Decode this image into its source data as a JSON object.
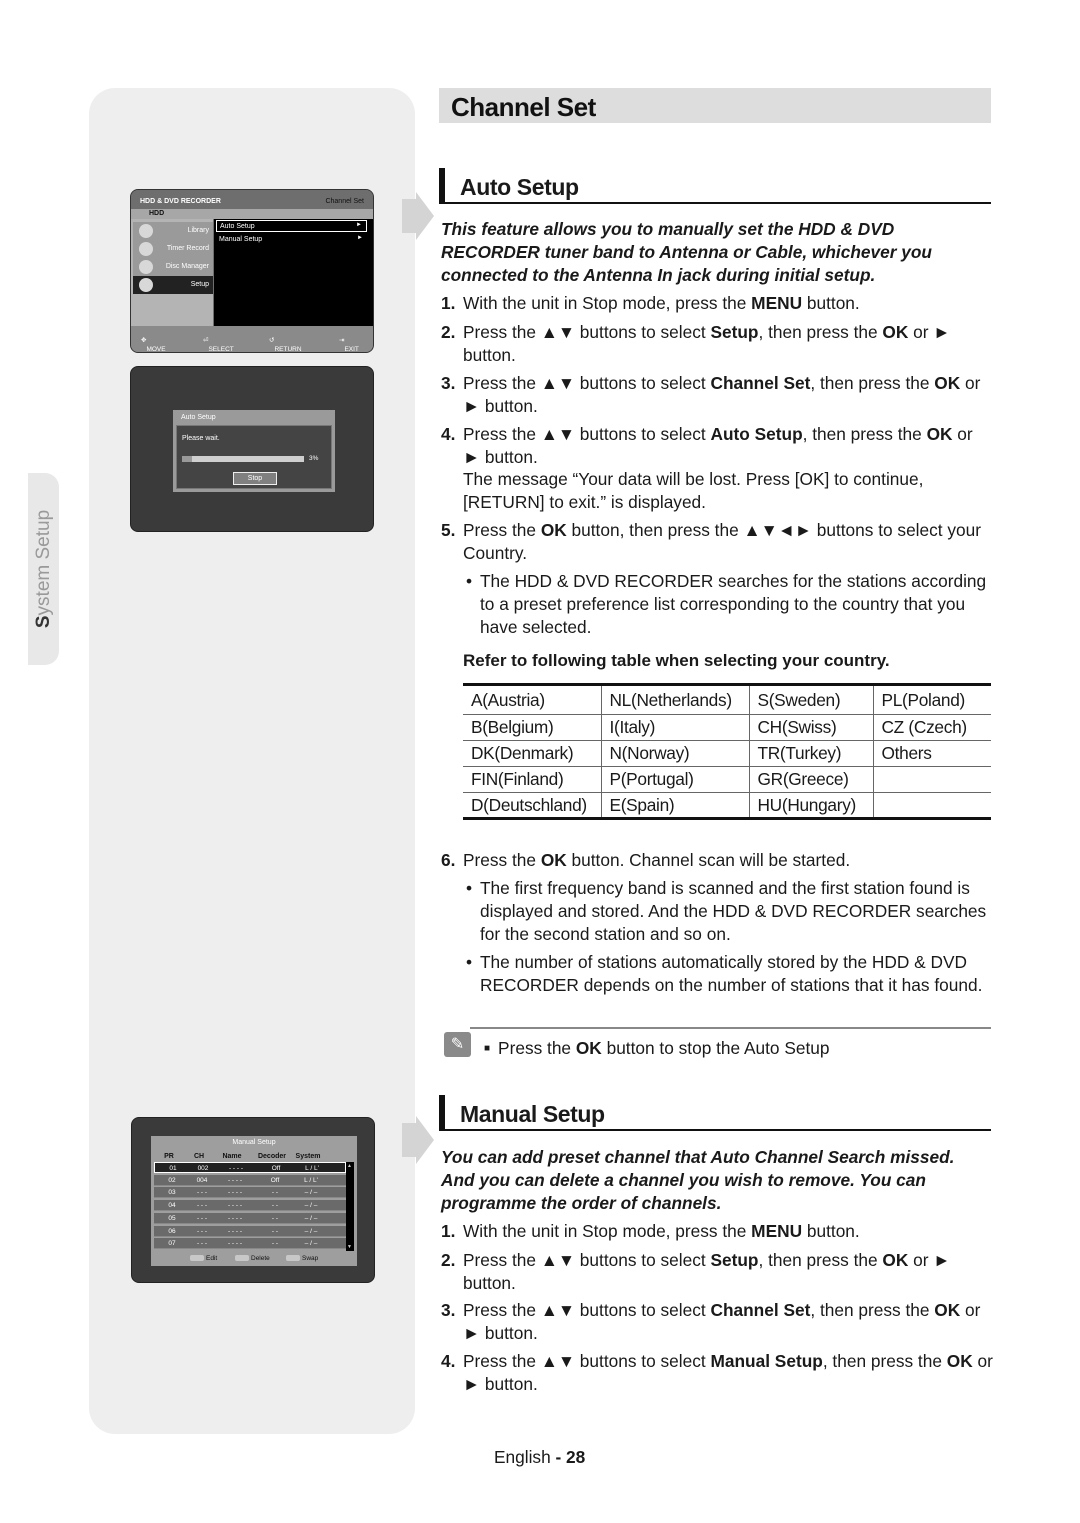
{
  "side_tab": {
    "label_first": "S",
    "label_rest": "ystem Setup"
  },
  "screen1": {
    "header_title": "HDD & DVD RECORDER",
    "header_right": "Channel Set",
    "hdd_label": "HDD",
    "menu": [
      {
        "label": "Library",
        "icon": "library-icon"
      },
      {
        "label": "Timer Record",
        "icon": "timer-icon"
      },
      {
        "label": "Disc Manager",
        "icon": "disc-icon"
      },
      {
        "label": "Setup",
        "icon": "gear-icon",
        "active": true
      }
    ],
    "options": [
      {
        "label": "Auto Setup",
        "arrow": "►",
        "selected": true
      },
      {
        "label": "Manual Setup",
        "arrow": "►"
      }
    ],
    "footer": {
      "move": "MOVE",
      "select": "SELECT",
      "return": "RETURN",
      "exit": "EXIT"
    }
  },
  "screen2": {
    "title": "Auto Setup",
    "message": "Please wait.",
    "progress_percent": 3,
    "progress_label": "3%",
    "stop_label": "Stop"
  },
  "screen3": {
    "title": "Manual Setup",
    "columns": [
      "PR",
      "CH",
      "Name",
      "Decoder",
      "System"
    ],
    "rows": [
      [
        "01",
        "002",
        "- - - -",
        "Off",
        "L / L'"
      ],
      [
        "02",
        "004",
        "- - - -",
        "Off",
        "L / L'"
      ],
      [
        "03",
        "- - -",
        "- - - -",
        "- -",
        "– / –"
      ],
      [
        "04",
        "- - -",
        "- - - -",
        "- -",
        "– / –"
      ],
      [
        "05",
        "- - -",
        "- - - -",
        "- -",
        "– / –"
      ],
      [
        "06",
        "- - -",
        "- - - -",
        "- -",
        "– / –"
      ],
      [
        "07",
        "- - -",
        "- - - -",
        "- -",
        "– / –"
      ]
    ],
    "footer": {
      "edit": "Edit",
      "delete": "Delete",
      "swap": "Swap"
    }
  },
  "page_title": "Channel Set",
  "auto_setup": {
    "heading": "Auto Setup",
    "intro": "This feature allows you to manually set the HDD & DVD RECORDER tuner band to Antenna or Cable, whichever you connected to the Antenna In jack during initial setup.",
    "steps": [
      {
        "n": "1.",
        "pre": "With the unit in Stop mode, press the ",
        "b1": "MENU",
        "mid": " button.",
        "b2": "",
        "post": ""
      },
      {
        "n": "2.",
        "pre": "Press the ▲▼ buttons to select ",
        "b1": "Setup",
        "mid": ", then press the ",
        "b2": "OK",
        "post": " or ► button."
      },
      {
        "n": "3.",
        "pre": "Press the ▲▼ buttons to select ",
        "b1": "Channel Set",
        "mid": ", then press the ",
        "b2": "OK",
        "post": " or ► button."
      },
      {
        "n": "4.",
        "pre": "Press the ▲▼ buttons to select ",
        "b1": "Auto Setup",
        "mid": ", then press the ",
        "b2": "OK",
        "post": " or ► button."
      },
      {
        "n": "5.",
        "pre": "Press the ",
        "b1": "OK",
        "mid": " button, then press the ▲▼◄► buttons to select your Country.",
        "b2": "",
        "post": ""
      },
      {
        "n": "6.",
        "pre": "Press the ",
        "b1": "OK",
        "mid": " button. Channel scan will be started.",
        "b2": "",
        "post": ""
      }
    ],
    "step4_message": "The message “Your data will be lost. Press [OK] to continue, [RETURN] to exit.” is displayed.",
    "step5_bullet": "The HDD & DVD RECORDER searches for the stations according to a preset preference list corresponding to the country that you have selected.",
    "table_heading": "Refer to following table when selecting your country.",
    "countries": [
      [
        "A(Austria)",
        "NL(Netherlands)",
        "S(Sweden)",
        "PL(Poland)"
      ],
      [
        "B(Belgium)",
        "I(Italy)",
        "CH(Swiss)",
        "CZ (Czech)"
      ],
      [
        "DK(Denmark)",
        "N(Norway)",
        "TR(Turkey)",
        "Others"
      ],
      [
        "FIN(Finland)",
        "P(Portugal)",
        "GR(Greece)",
        ""
      ],
      [
        "D(Deutschland)",
        "E(Spain)",
        "HU(Hungary)",
        ""
      ]
    ],
    "step6_bullets": [
      "The first frequency band is scanned and the first station found is displayed and stored. And the HDD & DVD RECORDER searches for the second station and so on.",
      "The number of stations automatically stored by the HDD & DVD RECORDER depends on the number of stations that it has found."
    ],
    "note": {
      "pre": "Press the ",
      "b": "OK",
      "post": " button to stop the Auto Setup"
    }
  },
  "manual_setup": {
    "heading": "Manual Setup",
    "intro": "You can add preset channel that Auto Channel Search missed. And you can delete a channel you wish to remove. You can programme the order of channels.",
    "steps": [
      {
        "n": "1.",
        "pre": "With the unit in Stop mode, press the ",
        "b1": "MENU",
        "mid": " button.",
        "b2": "",
        "post": ""
      },
      {
        "n": "2.",
        "pre": "Press the ▲▼ buttons to select ",
        "b1": "Setup",
        "mid": ", then press the ",
        "b2": "OK",
        "post": " or ► button."
      },
      {
        "n": "3.",
        "pre": "Press the ▲▼  buttons to select ",
        "b1": "Channel Set",
        "mid": ", then press the ",
        "b2": "OK",
        "post": " or ► button."
      },
      {
        "n": "4.",
        "pre": "Press the ▲▼  buttons to select ",
        "b1": "Manual Setup",
        "mid": ", then press the ",
        "b2": "OK",
        "post": " or ► button."
      }
    ]
  },
  "footer": {
    "language": "English",
    "separator": " - ",
    "page": "28"
  }
}
